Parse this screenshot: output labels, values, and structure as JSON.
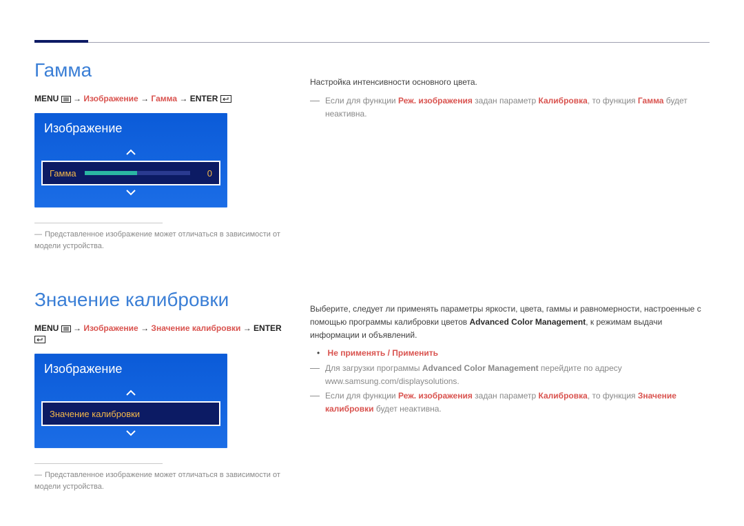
{
  "section1": {
    "title": "Гамма",
    "breadcrumb": {
      "p1": "MENU",
      "arrow": " → ",
      "p2": "Изображение",
      "p3": "Гамма",
      "p4": "ENTER"
    },
    "osd": {
      "header": "Изображение",
      "row_label": "Гамма",
      "row_value": "0"
    },
    "caption": "Представленное изображение может отличаться в зависимости от модели устройства.",
    "right": {
      "line1": "Настройка интенсивности основного цвета.",
      "note_prefix": "Если для функции ",
      "note_mode": "Реж. изображения",
      "note_mid": " задан параметр ",
      "note_calib": "Калибровка",
      "note_mid2": ", то функция ",
      "note_gamma": "Гамма",
      "note_suffix": " будет неактивна."
    }
  },
  "section2": {
    "title": "Значение калибровки",
    "breadcrumb": {
      "p1": "MENU",
      "arrow": " → ",
      "p2": "Изображение",
      "p3": "Значение калибровки",
      "p4": "ENTER"
    },
    "osd": {
      "header": "Изображение",
      "row_label": "Значение калибровки"
    },
    "caption": "Представленное изображение может отличаться в зависимости от модели устройства.",
    "right": {
      "para_a": "Выберите, следует ли применять параметры яркости, цвета, гаммы и равномерности, настроенные с помощью программы калибровки цветов ",
      "para_b": "Advanced Color Management",
      "para_c": ", к режимам выдачи информации и объявлений.",
      "bullet": "Не применять / Применить",
      "note1_a": "Для загрузки программы ",
      "note1_b": "Advanced Color Management",
      "note1_c": " перейдите по адресу www.samsung.com/displaysolutions.",
      "note2_a": "Если для функции ",
      "note2_b": "Реж. изображения",
      "note2_c": " задан параметр ",
      "note2_d": "Калибровка",
      "note2_e": ", то функция ",
      "note2_f": "Значение калибровки",
      "note2_g": " будет неактивна."
    }
  }
}
